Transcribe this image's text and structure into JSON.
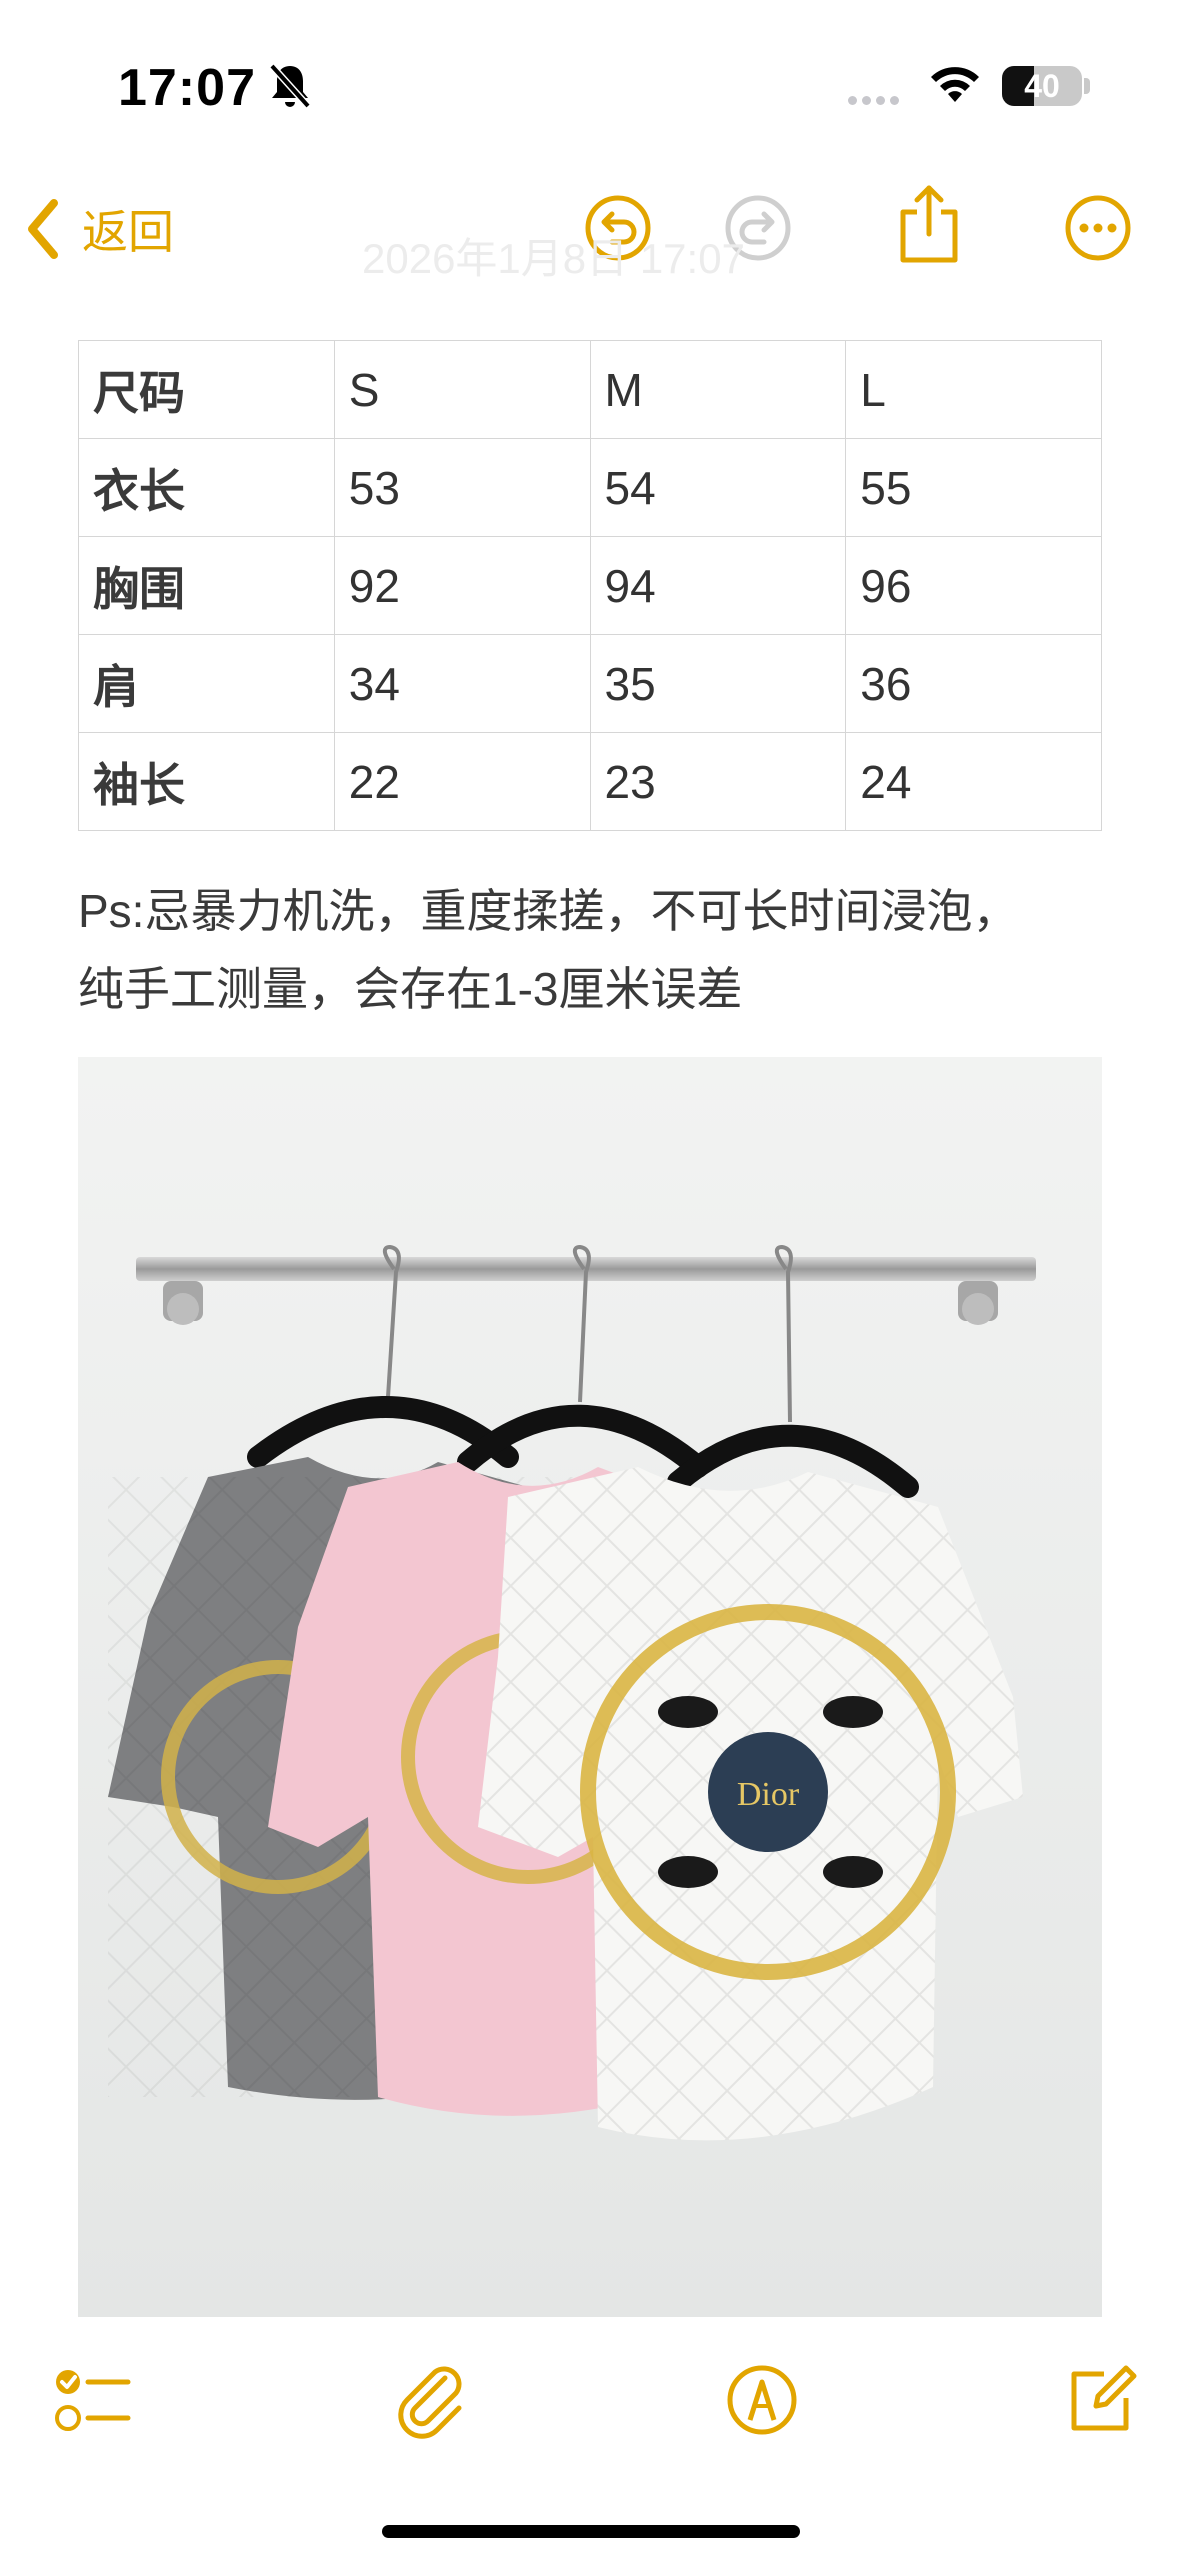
{
  "status_bar": {
    "time": "17:07",
    "battery": "40",
    "battery_level": 0.4,
    "icons": [
      "bell-slash-icon",
      "cellular-icon",
      "wifi-icon",
      "battery-icon"
    ]
  },
  "nav": {
    "back_label": "返回",
    "ghost_date": "2026年1月8日 17:07",
    "icons": [
      "chevron-left-icon",
      "undo-icon",
      "redo-icon",
      "share-icon",
      "more-icon"
    ]
  },
  "size_table": {
    "header": [
      "尺码",
      "S",
      "M",
      "L"
    ],
    "rows": [
      [
        "衣长",
        "53",
        "54",
        "55"
      ],
      [
        "胸围",
        "92",
        "94",
        "96"
      ],
      [
        "肩",
        "34",
        "35",
        "36"
      ],
      [
        "袖长",
        "22",
        "23",
        "24"
      ]
    ]
  },
  "note": {
    "line1": "Ps:忌暴力机洗，重度揉搓，不可长时间浸泡，",
    "line2": "纯手工测量，会存在1-3厘米误差"
  },
  "photo": {
    "label_text": "Dior"
  },
  "toolbar": {
    "icons": [
      "checklist-icon",
      "paperclip-icon",
      "markup-pen-icon",
      "compose-icon"
    ]
  },
  "colors": {
    "accent": "#e2a500",
    "text": "#333333",
    "border": "#d6d6d6"
  }
}
